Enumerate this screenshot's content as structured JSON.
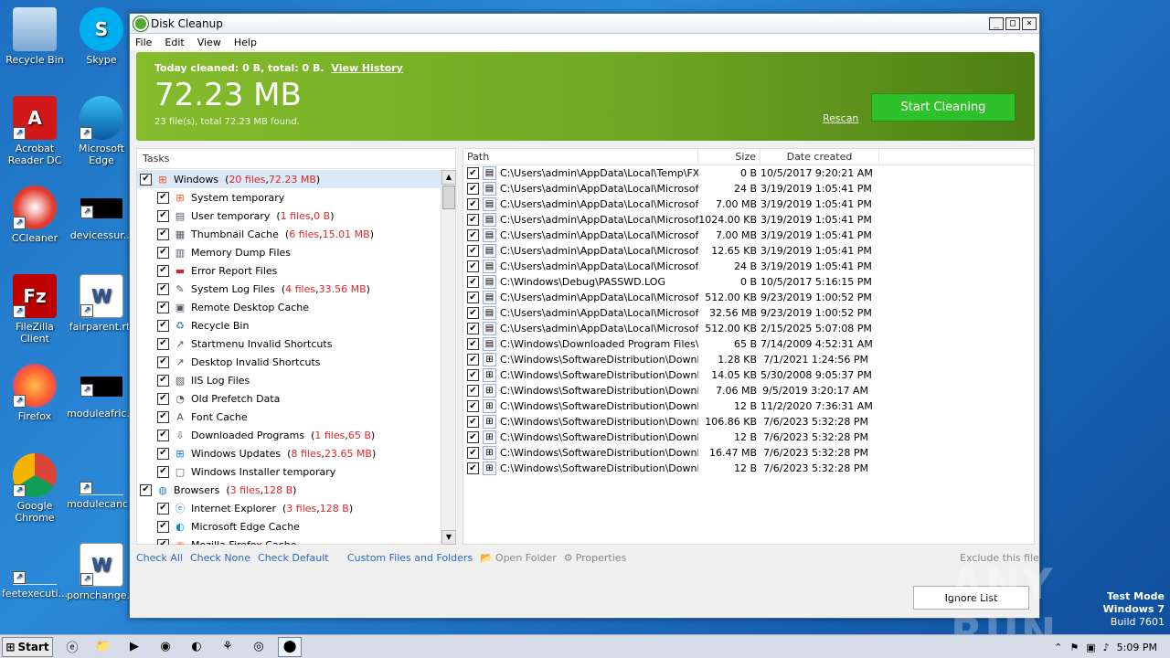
{
  "desktop": {
    "icons": [
      {
        "label": "Recycle Bin",
        "name": "recycle-bin-icon"
      },
      {
        "label": "Skype",
        "name": "skype-icon"
      },
      {
        "label": "Acrobat Reader DC",
        "name": "acrobat-icon"
      },
      {
        "label": "Microsoft Edge",
        "name": "edge-icon"
      },
      {
        "label": "CCleaner",
        "name": "ccleaner-icon"
      },
      {
        "label": "devicessur...",
        "name": "file-icon"
      },
      {
        "label": "FileZilla Client",
        "name": "filezilla-icon"
      },
      {
        "label": "fairparent.rtf",
        "name": "word-doc-icon"
      },
      {
        "label": "Firefox",
        "name": "firefox-icon"
      },
      {
        "label": "moduleafric...",
        "name": "file-icon"
      },
      {
        "label": "Google Chrome",
        "name": "chrome-icon"
      },
      {
        "label": "modulecanc...",
        "name": "file-icon"
      },
      {
        "label": "feetexecuti...",
        "name": "file-icon"
      },
      {
        "label": "pornchange...",
        "name": "word-doc-icon"
      }
    ]
  },
  "window": {
    "title": "Disk Cleanup",
    "buttons": {
      "minimize": "_",
      "maximize": "□",
      "close": "×"
    },
    "menu": [
      "File",
      "Edit",
      "View",
      "Help"
    ]
  },
  "banner": {
    "today": "Today cleaned: 0 B, total: 0 B.",
    "history_link": "View History",
    "size": "72.23 MB",
    "found": "23 file(s), total 72.23 MB found.",
    "rescan": "Rescan",
    "start": "Start Cleaning",
    "colors": {
      "green_start": "#84bc2c",
      "green_end": "#4d7f14",
      "button": "#2fc12a"
    }
  },
  "tasks": {
    "header": "Tasks",
    "items": [
      {
        "label": "Windows",
        "detail_pre": "(",
        "files": "20 files",
        "sep": ", ",
        "size": "72.23 MB",
        "detail_post": ")",
        "level": 0,
        "icon": "windows-icon",
        "selected": true
      },
      {
        "label": "System temporary",
        "level": 1,
        "icon": "windows-icon"
      },
      {
        "label": "User temporary",
        "detail_pre": "(",
        "files": "1 files",
        "sep": ", ",
        "size": "0 B",
        "detail_post": ")",
        "level": 1,
        "icon": "user-temp-icon"
      },
      {
        "label": "Thumbnail Cache",
        "detail_pre": "(",
        "files": "6 files",
        "sep": ", ",
        "size": "15.01 MB",
        "detail_post": ")",
        "level": 1,
        "icon": "thumbnail-icon"
      },
      {
        "label": "Memory Dump Files",
        "level": 1,
        "icon": "memory-icon"
      },
      {
        "label": "Error Report Files",
        "level": 1,
        "icon": "error-report-icon"
      },
      {
        "label": "System Log Files",
        "detail_pre": "(",
        "files": "4 files",
        "sep": ", ",
        "size": "33.56 MB",
        "detail_post": ")",
        "level": 1,
        "icon": "log-icon"
      },
      {
        "label": "Remote Desktop Cache",
        "level": 1,
        "icon": "remote-desktop-icon"
      },
      {
        "label": "Recycle Bin",
        "level": 1,
        "icon": "recycle-bin-icon"
      },
      {
        "label": "Startmenu Invalid Shortcuts",
        "level": 1,
        "icon": "shortcut-icon"
      },
      {
        "label": "Desktop Invalid Shortcuts",
        "level": 1,
        "icon": "shortcut-icon"
      },
      {
        "label": "IIS Log Files",
        "level": 1,
        "icon": "iis-icon"
      },
      {
        "label": "Old Prefetch Data",
        "level": 1,
        "icon": "prefetch-icon"
      },
      {
        "label": "Font Cache",
        "level": 1,
        "icon": "font-icon"
      },
      {
        "label": "Downloaded Programs",
        "detail_pre": "(",
        "files": "1 files",
        "sep": ", ",
        "size": "65 B",
        "detail_post": ")",
        "level": 1,
        "icon": "download-icon"
      },
      {
        "label": "Windows Updates",
        "detail_pre": "(",
        "files": "8 files",
        "sep": ", ",
        "size": "23.65 MB",
        "detail_post": ")",
        "level": 1,
        "icon": "windows-update-icon"
      },
      {
        "label": "Windows Installer temporary",
        "level": 1,
        "icon": "installer-icon"
      },
      {
        "label": "Browsers",
        "detail_pre": "(",
        "files": "3 files",
        "sep": ", ",
        "size": "128 B",
        "detail_post": ")",
        "level": 0,
        "icon": "globe-icon"
      },
      {
        "label": "Internet Explorer",
        "detail_pre": "(",
        "files": "3 files",
        "sep": ", ",
        "size": "128 B",
        "detail_post": ")",
        "level": 1,
        "icon": "ie-icon"
      },
      {
        "label": "Microsoft Edge Cache",
        "level": 1,
        "icon": "edge-icon"
      },
      {
        "label": "Mozilla Firefox Cache",
        "level": 1,
        "icon": "firefox-icon"
      }
    ]
  },
  "files": {
    "columns": {
      "path": "Path",
      "size": "Size",
      "date": "Date created"
    },
    "rows": [
      {
        "path": "C:\\Users\\admin\\AppData\\Local\\Temp\\FX...",
        "size": "0 B",
        "date": "10/5/2017 9:20:21 AM"
      },
      {
        "path": "C:\\Users\\admin\\AppData\\Local\\Microsoft...",
        "size": "24 B",
        "date": "3/19/2019 1:05:41 PM"
      },
      {
        "path": "C:\\Users\\admin\\AppData\\Local\\Microsoft...",
        "size": "7.00 MB",
        "date": "3/19/2019 1:05:41 PM"
      },
      {
        "path": "C:\\Users\\admin\\AppData\\Local\\Microsoft...",
        "size": "1024.00 KB",
        "date": "3/19/2019 1:05:41 PM"
      },
      {
        "path": "C:\\Users\\admin\\AppData\\Local\\Microsoft...",
        "size": "7.00 MB",
        "date": "3/19/2019 1:05:41 PM"
      },
      {
        "path": "C:\\Users\\admin\\AppData\\Local\\Microsoft...",
        "size": "12.65 KB",
        "date": "3/19/2019 1:05:41 PM"
      },
      {
        "path": "C:\\Users\\admin\\AppData\\Local\\Microsoft...",
        "size": "24 B",
        "date": "3/19/2019 1:05:41 PM"
      },
      {
        "path": "C:\\Windows\\Debug\\PASSWD.LOG",
        "size": "0 B",
        "date": "10/5/2017 5:16:15 PM"
      },
      {
        "path": "C:\\Users\\admin\\AppData\\Local\\Microsoft...",
        "size": "512.00 KB",
        "date": "9/23/2019 1:00:52 PM"
      },
      {
        "path": "C:\\Users\\admin\\AppData\\Local\\Microsoft...",
        "size": "32.56 MB",
        "date": "9/23/2019 1:00:52 PM"
      },
      {
        "path": "C:\\Users\\admin\\AppData\\Local\\Microsoft...",
        "size": "512.00 KB",
        "date": "2/15/2025 5:07:08 PM"
      },
      {
        "path": "C:\\Windows\\Downloaded Program Files\\...",
        "size": "65 B",
        "date": "7/14/2009 4:52:31 AM"
      },
      {
        "path": "C:\\Windows\\SoftwareDistribution\\Downl...",
        "size": "1.28 KB",
        "date": "7/1/2021 1:24:56 PM"
      },
      {
        "path": "C:\\Windows\\SoftwareDistribution\\Downl...",
        "size": "14.05 KB",
        "date": "5/30/2008 9:05:37 PM"
      },
      {
        "path": "C:\\Windows\\SoftwareDistribution\\Downl...",
        "size": "7.06 MB",
        "date": "9/5/2019 3:20:17 AM"
      },
      {
        "path": "C:\\Windows\\SoftwareDistribution\\Downl...",
        "size": "12 B",
        "date": "11/2/2020 7:36:31 AM"
      },
      {
        "path": "C:\\Windows\\SoftwareDistribution\\Downl...",
        "size": "106.86 KB",
        "date": "7/6/2023 5:32:28 PM"
      },
      {
        "path": "C:\\Windows\\SoftwareDistribution\\Downl...",
        "size": "12 B",
        "date": "7/6/2023 5:32:28 PM"
      },
      {
        "path": "C:\\Windows\\SoftwareDistribution\\Downl...",
        "size": "16.47 MB",
        "date": "7/6/2023 5:32:28 PM"
      },
      {
        "path": "C:\\Windows\\SoftwareDistribution\\Downl...",
        "size": "12 B",
        "date": "7/6/2023 5:32:28 PM"
      }
    ]
  },
  "bottom": {
    "check_all": "Check All",
    "check_none": "Check None",
    "check_default": "Check Default",
    "custom": "Custom Files and Folders",
    "open_folder": "Open Folder",
    "properties": "Properties",
    "exclude": "Exclude this file",
    "ignore": "Ignore List"
  },
  "taskbar": {
    "start": "Start",
    "time": "5:09 PM"
  },
  "watermark": {
    "line1": "Test Mode",
    "line2": "Windows 7",
    "line3": "Build 7601",
    "brand": "ANY RUN"
  }
}
